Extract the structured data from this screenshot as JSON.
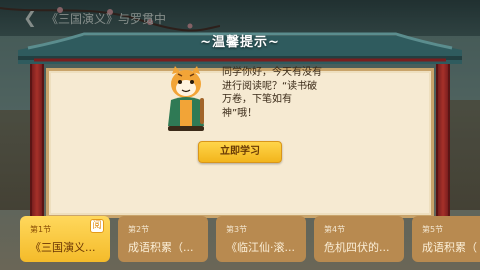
{
  "header": {
    "back_icon": "chevron-left-icon",
    "title": "《三国演义》与罗贯中"
  },
  "dialog": {
    "title": "~温馨提示~",
    "message": "同学你好，今天有没有进行阅读呢？“读书破万卷，下笔如有神”哦！",
    "button_label": "立即学习",
    "mascot_icon": "tiger-mascot-icon"
  },
  "lessons": [
    {
      "num": "第1节",
      "name": "《三国演义...",
      "active": true,
      "badge": "阅"
    },
    {
      "num": "第2节",
      "name": "成语积累（...",
      "active": false
    },
    {
      "num": "第3节",
      "name": "《临江仙·滚...",
      "active": false
    },
    {
      "num": "第4节",
      "name": "危机四伏的...",
      "active": false
    },
    {
      "num": "第5节",
      "name": "成语积累（",
      "active": false
    }
  ],
  "colors": {
    "accent": "#f4bb2a",
    "card": "#b88a50",
    "pillar": "#a73129",
    "roof": "#3f6f72"
  }
}
